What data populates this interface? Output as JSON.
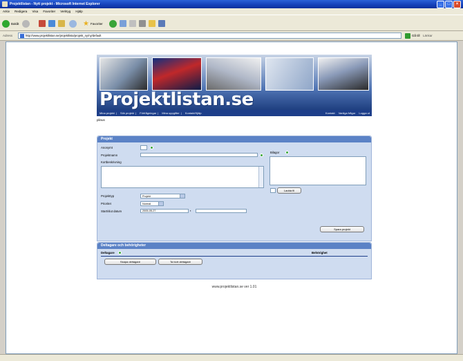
{
  "browser": {
    "title": "Projektlistan - Nytt projekt - Microsoft Internet Explorer",
    "menu": [
      "Arkiv",
      "Redigera",
      "Visa",
      "Favoriter",
      "Verktyg",
      "Hjälp"
    ],
    "back_label": "Bakåt",
    "favorites_label": "Favoriter",
    "address_label": "Adress",
    "url": "http://www.projektlistan.se/projektlista/projekt_ny/ny/default",
    "go_label": "Gå till",
    "links_label": "Länkar"
  },
  "site": {
    "logo": "Projektlistan.se",
    "nav_left": [
      "Mina projekt",
      "Sök projekt",
      "Förfrågningar",
      "Mina uppgifter",
      "Kontakt/Hjälp"
    ],
    "nav_right": [
      "Kontakt",
      "Vanliga frågor",
      "Logga ut"
    ],
    "user": "plinus"
  },
  "projekt_panel": {
    "title": "Projekt",
    "anonym_label": "Anonymt",
    "projektnamn_label": "Projektnamn",
    "kortbeskrivning_label": "Kortbeskrivning",
    "bilagor_label": "Bilagor",
    "ladda_label": "Ladda fil",
    "projekttyp_label": "Projekttyp",
    "projekttyp_value": "Projekt",
    "prioritet_label": "Prioritet",
    "prioritet_value": "Normal",
    "startdatum_label": "Start/slut datum",
    "startdatum_value": "2005-05-27",
    "spara_label": "Spara projekt"
  },
  "deltagare_panel": {
    "title": "Deltagare och behörigheter",
    "col_deltagare": "Deltagare",
    "col_behorighet": "Behörighet",
    "add_button": "Skapa deltagare",
    "remove_button": "Ta bort deltagare"
  },
  "footer": "www.projektlistan.se ver 1.01"
}
